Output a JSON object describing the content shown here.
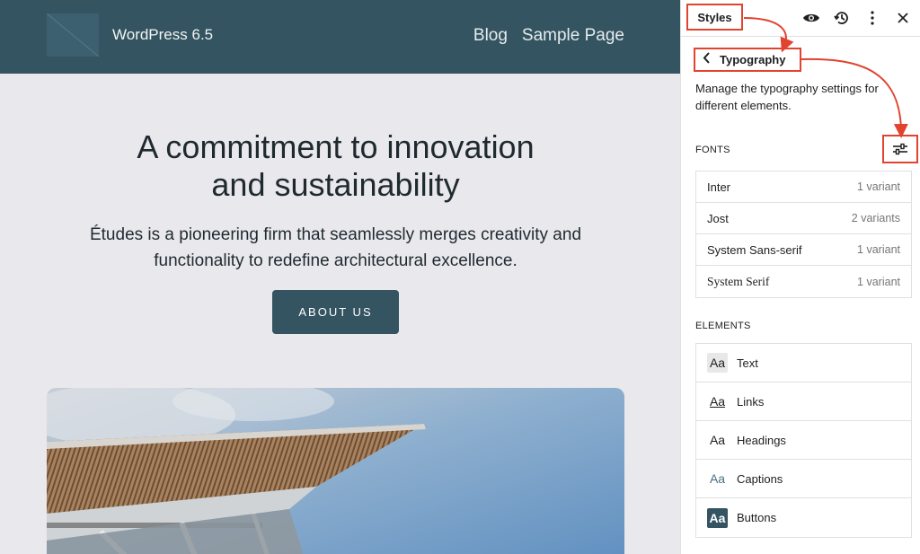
{
  "canvas": {
    "site_title": "WordPress 6.5",
    "nav": [
      "Blog",
      "Sample Page"
    ],
    "hero_title_line1": "A commitment to innovation",
    "hero_title_line2": "and sustainability",
    "hero_text_line1": "Études is a pioneering firm that seamlessly merges creativity and",
    "hero_text_line2": "functionality to redefine architectural excellence.",
    "cta_label": "ABOUT US"
  },
  "sidebar": {
    "title": "Styles",
    "actions": [
      "eye-icon",
      "history-icon",
      "more-vertical-icon",
      "close-icon"
    ],
    "nav_back_icon": "chevron-left-icon",
    "nav_label": "Typography",
    "description_line1": "Manage the typography settings for",
    "description_line2": "different elements.",
    "fonts_heading": "FONTS",
    "fonts_button_icon": "sliders-icon",
    "fonts": [
      {
        "name": "Inter",
        "count": "1 variant"
      },
      {
        "name": "Jost",
        "count": "2 variants"
      },
      {
        "name": "System Sans-serif",
        "count": "1 variant"
      },
      {
        "name": "System Serif",
        "count": "1 variant"
      }
    ],
    "elements_heading": "ELEMENTS",
    "elements": [
      {
        "icon": "Aa",
        "label": "Text"
      },
      {
        "icon": "Aa",
        "label": "Links"
      },
      {
        "icon": "Aa",
        "label": "Headings"
      },
      {
        "icon": "Aa",
        "label": "Captions"
      },
      {
        "icon": "Aa",
        "label": "Buttons"
      }
    ]
  },
  "colors": {
    "header_bg": "#335460",
    "canvas_bg": "#e9e8ec",
    "highlight": "#e1432f"
  }
}
